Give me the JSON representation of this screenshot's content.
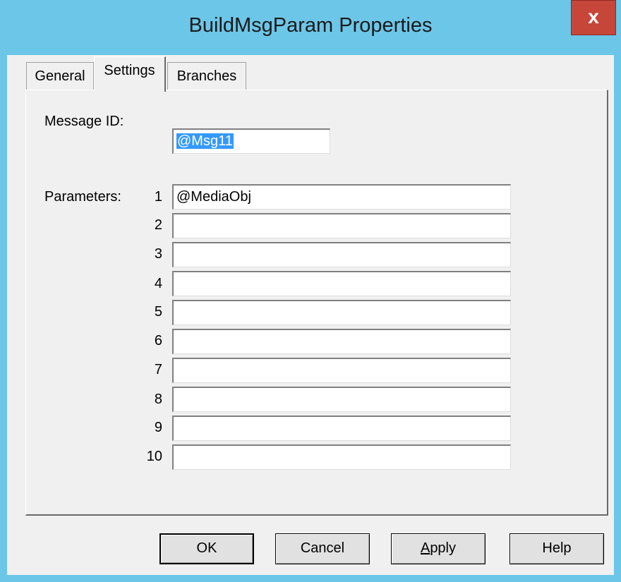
{
  "window": {
    "title": "BuildMsgParam Properties",
    "close_label": "x"
  },
  "tabs": [
    {
      "label": "General",
      "active": false
    },
    {
      "label": "Settings",
      "active": true
    },
    {
      "label": "Branches",
      "active": false
    }
  ],
  "settings": {
    "message_id_label": "Message ID:",
    "message_id_value": "@Msg11",
    "parameters_label": "Parameters:",
    "parameters": [
      {
        "num": "1",
        "value": "@MediaObj"
      },
      {
        "num": "2",
        "value": ""
      },
      {
        "num": "3",
        "value": ""
      },
      {
        "num": "4",
        "value": ""
      },
      {
        "num": "5",
        "value": ""
      },
      {
        "num": "6",
        "value": ""
      },
      {
        "num": "7",
        "value": ""
      },
      {
        "num": "8",
        "value": ""
      },
      {
        "num": "9",
        "value": ""
      },
      {
        "num": "10",
        "value": ""
      }
    ]
  },
  "buttons": {
    "ok": "OK",
    "cancel": "Cancel",
    "apply_accel": "A",
    "apply_rest": "pply",
    "help": "Help"
  }
}
